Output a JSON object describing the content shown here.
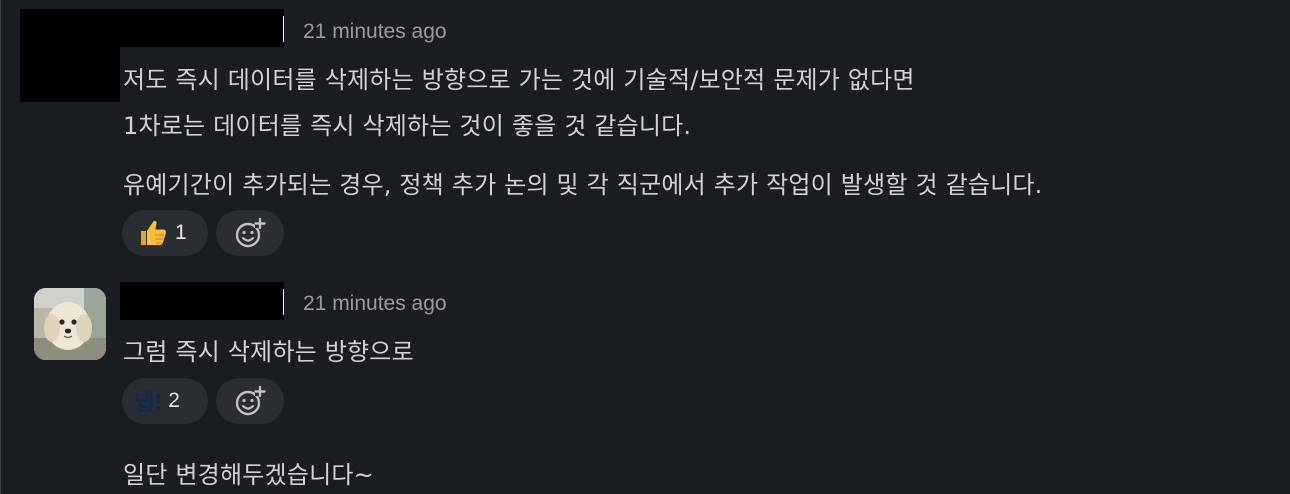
{
  "messages": [
    {
      "timestamp": "21 minutes ago",
      "lines": [
        "저도 즉시 데이터를 삭제하는 방향으로 가는 것에 기술적/보안적 문제가 없다면",
        "1차로는 데이터를 즉시 삭제하는 것이 좋을 것 같습니다.",
        "유예기간이 추가되는 경우, 정책 추가 논의 및 각 직군에서 추가 작업이 발생할 것 같습니다."
      ],
      "reaction": {
        "emoji_icon": "thumbs-up-icon",
        "count": "1"
      }
    },
    {
      "timestamp": "21 minutes ago",
      "lines": [
        "그럼 즉시 삭제하는 방향으로"
      ],
      "reaction": {
        "emoji_text": "넵!",
        "count": "2"
      }
    },
    {
      "lines": [
        "일단 변경해두겠습니다~"
      ]
    }
  ],
  "add_reaction_icon": "add-reaction-icon",
  "avatar_icon": "dog-avatar-icon",
  "colors": {
    "background": "#1a1d21",
    "text": "#d1d2d3",
    "timestamp": "#9a9b9d",
    "pill": "#2a2d31",
    "redaction": "#000000"
  }
}
